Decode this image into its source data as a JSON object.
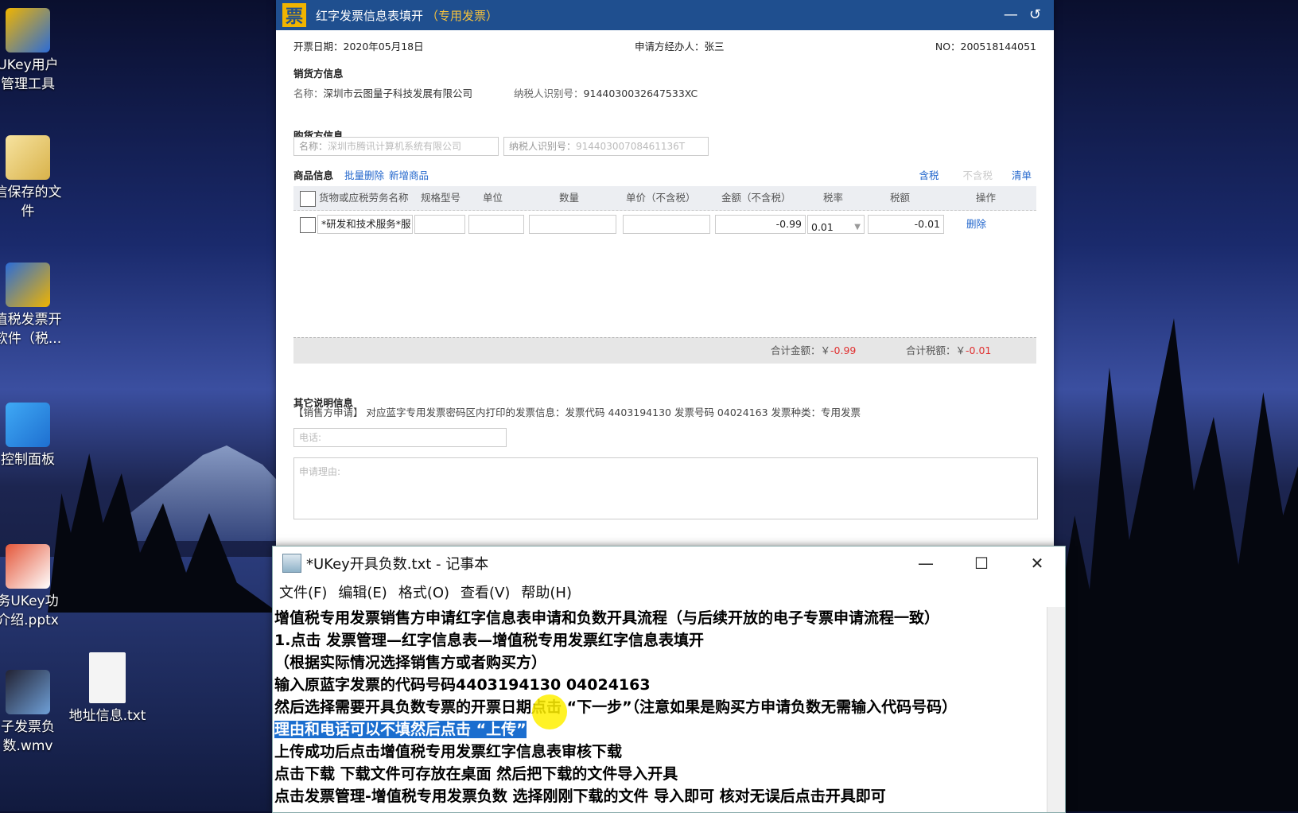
{
  "desktop": {
    "icons": [
      {
        "label": "UKey用户\n管理工具"
      },
      {
        "label": "信保存的文\n件"
      },
      {
        "label": "值税发票开\n软件（税..."
      },
      {
        "label": "控制面板"
      },
      {
        "label": "务UKey功\n介绍.pptx"
      },
      {
        "label": "子发票负\n数.wmv"
      },
      {
        "label": "地址信息.txt"
      }
    ]
  },
  "invoice_window": {
    "logo_glyph": "票",
    "title": "红字发票信息表填开",
    "title_sub": "（专用发票）",
    "controls": {
      "minimize": "—",
      "back": "↺"
    },
    "issue_date": "开票日期：2020年05月18日",
    "applicant": "申请方经办人：张三",
    "number": "NO：200518144051",
    "seller": {
      "section": "销货方信息",
      "name_label": "名称：",
      "name": "深圳市云图量子科技发展有限公司",
      "tax_label": "纳税人识别号：",
      "tax_id": "9144030032647533XC"
    },
    "buyer": {
      "section": "购货方信息",
      "name_label": "名称：",
      "name_placeholder": "深圳市腾讯计算机系统有限公司",
      "tax_label": "纳税人识别号：",
      "tax_placeholder": "91440300708461136T"
    },
    "goods": {
      "section": "商品信息",
      "batch_delete": "批量删除",
      "add_item": "新增商品",
      "tax_incl": "含税",
      "tax_excl": "不含税",
      "list": "清单",
      "columns": [
        "货物或应税劳务名称",
        "规格型号",
        "单位",
        "数量",
        "单价（不含税）",
        "金额（不含税）",
        "税率",
        "税额",
        "操作"
      ],
      "rows": [
        {
          "name": "*研发和技术服务*服",
          "spec": "",
          "unit": "",
          "qty": "",
          "price": "",
          "amount": "-0.99",
          "rate": "0.01",
          "tax": "-0.01",
          "action": "删除"
        }
      ]
    },
    "totals": {
      "amount_label": "合计金额：￥",
      "amount": "-0.99",
      "tax_label": "合计税额：￥",
      "tax": "-0.01"
    },
    "other": {
      "section": "其它说明信息",
      "note": "【销售方申请】 对应蓝字专用发票密码区内打印的发票信息：发票代码 4403194130 发票号码 04024163 发票种类：专用发票",
      "phone_placeholder": "电话:",
      "reason_placeholder": "申请理由:"
    }
  },
  "notepad": {
    "title": "*UKey开具负数.txt - 记事本",
    "controls": {
      "minimize": "—",
      "maximize": "☐",
      "close": "✕"
    },
    "menu": [
      "文件(F)",
      "编辑(E)",
      "格式(O)",
      "查看(V)",
      "帮助(H)"
    ],
    "lines": [
      "增值税专用发票销售方申请红字信息表申请和负数开具流程（与后续开放的电子专票申请流程一致）",
      "1.点击 发票管理—红字信息表—增值税专用发票红字信息表填开",
      "（根据实际情况选择销售方或者购买方）",
      "输入原蓝字发票的代码号码4403194130 04024163",
      "然后选择需要开具负数专票的开票日期点击 “下一步”（注意如果是购买方申请负数无需输入代码号码）",
      "理由和电话可以不填然后点击 “上传”",
      "上传成功后点击增值税专用发票红字信息表审核下载",
      "点击下载 下载文件可存放在桌面 然后把下载的文件导入开具",
      "点击发票管理-增值税专用发票负数 选择刚刚下载的文件 导入即可 核对无误后点击开具即可"
    ]
  }
}
